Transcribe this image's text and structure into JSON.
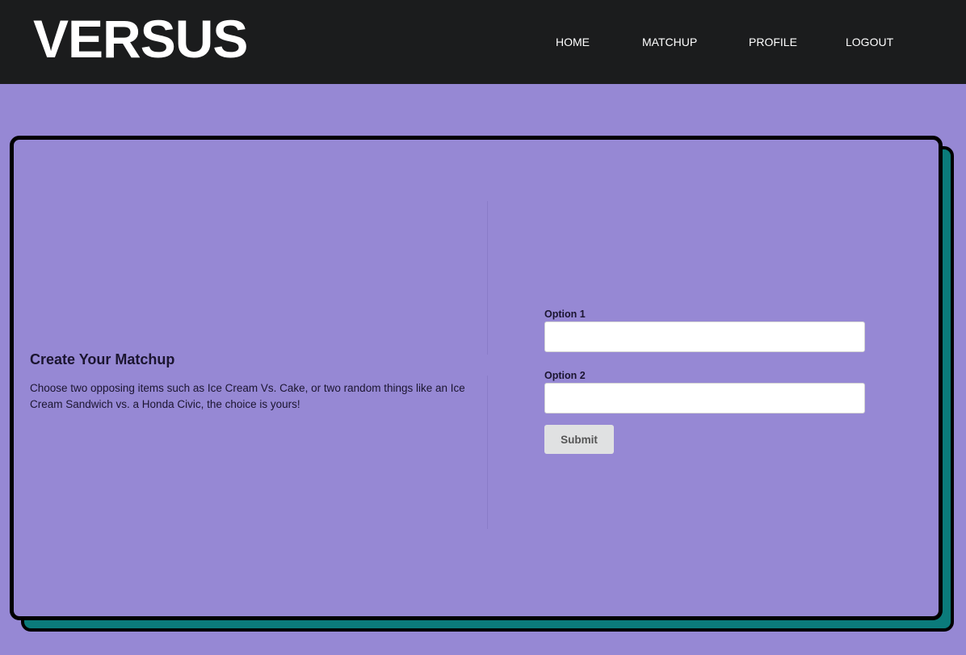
{
  "header": {
    "brand": "VERSUS",
    "nav": {
      "home": "HOME",
      "matchup": "MATCHUP",
      "profile": "PROFILE",
      "logout": "LOGOUT"
    }
  },
  "intro": {
    "title": "Create Your Matchup",
    "description": "Choose two opposing items such as Ice Cream Vs. Cake, or two random things like an Ice Cream Sandwich vs. a Honda Civic, the choice is yours!"
  },
  "form": {
    "option1_label": "Option 1",
    "option1_value": "",
    "option2_label": "Option 2",
    "option2_value": "",
    "submit_label": "Submit"
  },
  "colors": {
    "background": "#9688d4",
    "navbar": "#1b1c1d",
    "card_shadow": "#0b7b7b",
    "border": "#000000"
  }
}
